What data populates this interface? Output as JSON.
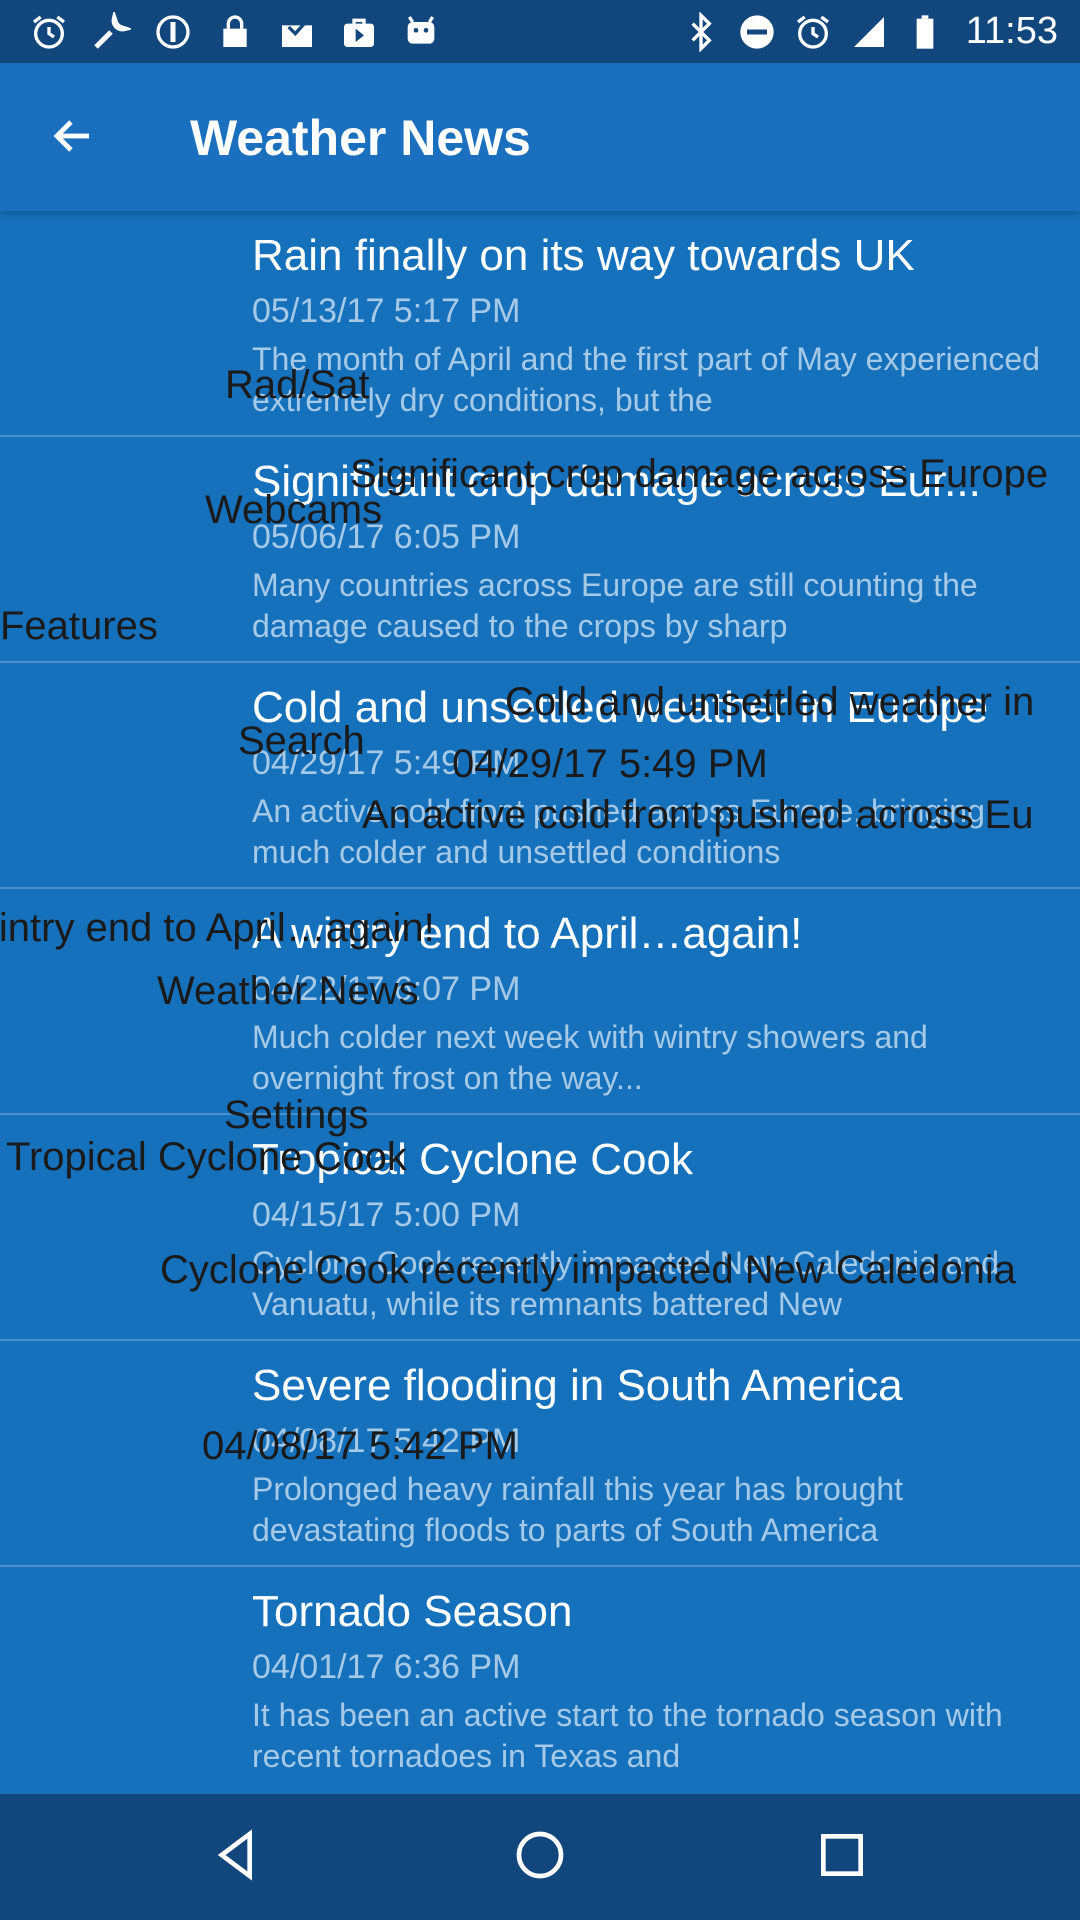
{
  "status_bar": {
    "time": "11:53",
    "left_icons": [
      "alarm-icon",
      "wrench-icon",
      "info-circle-icon",
      "lock-icon",
      "inbox-icon",
      "play-store-icon",
      "android-icon"
    ],
    "right_icons": [
      "bluetooth-icon",
      "do-not-disturb-icon",
      "alarm-icon",
      "signal-icon",
      "battery-icon"
    ]
  },
  "app_bar": {
    "title": "Weather News",
    "back_icon": "arrow-back-icon"
  },
  "news": [
    {
      "title": "Rain finally on its way towards UK",
      "date": "05/13/17 5:17 PM",
      "summary": "The month of April and the first part of May experienced extremely dry conditions, but the"
    },
    {
      "title": "Significant crop damage across Eur...",
      "date": "05/06/17 6:05 PM",
      "summary": "Many countries across Europe are still counting the damage caused to the crops by sharp"
    },
    {
      "title": "Cold and unsettled weather in Europe",
      "date": "04/29/17 5:49 PM",
      "summary": "An active cold front pushed across Europe, bringing much colder and unsettled conditions"
    },
    {
      "title": "A wintry end to April…again!",
      "date": "04/22/17 6:07 PM",
      "summary": "Much colder next week with wintry showers and overnight frost on the way..."
    },
    {
      "title": "Tropical Cyclone Cook",
      "date": "04/15/17 5:00 PM",
      "summary": "Cyclone Cook recently impacted New Caledonia and Vanuatu, while its remnants battered New"
    },
    {
      "title": "Severe flooding in South America",
      "date": "04/08/17 5:42 PM",
      "summary": "Prolonged heavy rainfall this year has brought devastating floods to parts of South America"
    },
    {
      "title": "Tornado Season",
      "date": "04/01/17 6:36 PM",
      "summary": "It has been an active start to the tornado season with recent tornadoes in Texas and"
    }
  ],
  "overlay": {
    "menu": {
      "rad_sat": "Rad/Sat",
      "webcams": "Webcams",
      "features": "Features",
      "search": "Search",
      "weather_news": "Weather News",
      "settings": "Settings"
    },
    "crop_title": "Significant crop damage across Europe",
    "cold_title": "Cold and unsettled weather in",
    "cold_date": "04/29/17 5:49 PM",
    "cold_summary": "An active cold front pushed across Eu",
    "wintry_title": "wintry end to April…again!",
    "cyclone_title": "Tropical Cyclone Cook",
    "cyclone_summary": "Cyclone Cook recently impacted New Caledonia",
    "flood_date": "04/08/17 5:42 PM"
  },
  "nav_bar": {
    "icons": [
      "back-triangle-icon",
      "home-circle-icon",
      "recents-square-icon"
    ]
  }
}
